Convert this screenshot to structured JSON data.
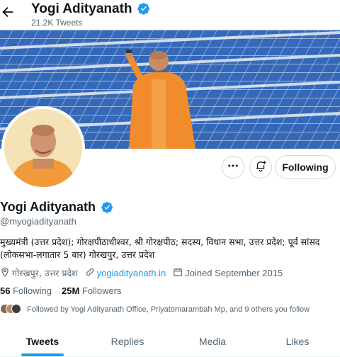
{
  "header": {
    "name": "Yogi Adityanath",
    "tweet_count": "21.2K Tweets"
  },
  "profile": {
    "name": "Yogi Adityanath",
    "handle": "@myogiadityanath",
    "bio_line1": "मुख्यमंत्री (उत्तर प्रदेश); गोरक्षपीठाधीश्वर, श्री गोरक्षपीठ; सदस्य, विधान सभा, उत्तर प्रदेश; पूर्व सांसद",
    "bio_line2": "(लोकसभा-लगातार 5 बार) गोरखपुर, उत्तर प्रदेश",
    "location": "गोरखपुर, उत्तर प्रदेश",
    "website": "yogiadityanath.in",
    "joined": "Joined September 2015",
    "following_count": "56",
    "following_label": "Following",
    "followers_count": "25M",
    "followers_label": "Followers",
    "followed_by": "Followed by Yogi Adityanath Office, Priyatomarambah Mp, and 9 others you follow"
  },
  "actions": {
    "following_button": "Following"
  },
  "tabs": [
    {
      "label": "Tweets",
      "active": true
    },
    {
      "label": "Replies",
      "active": false
    },
    {
      "label": "Media",
      "active": false
    },
    {
      "label": "Likes",
      "active": false
    }
  ],
  "colors": {
    "accent": "#1d9bf0",
    "saffron": "#f08c2c",
    "secondary_text": "#536471"
  },
  "icons": [
    "back-arrow-icon",
    "verified-badge-icon",
    "more-options-icon",
    "notification-bell-icon",
    "location-pin-icon",
    "link-icon",
    "calendar-icon"
  ]
}
